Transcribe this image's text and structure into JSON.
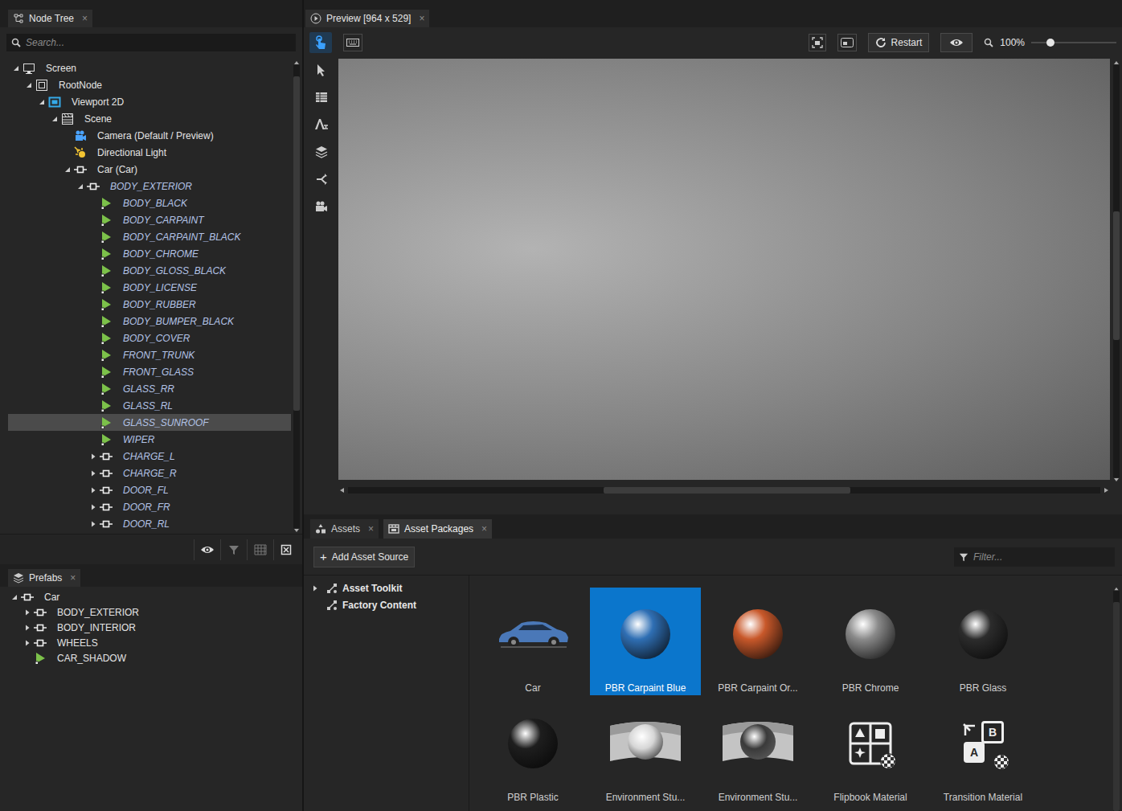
{
  "node_tree": {
    "title": "Node Tree",
    "close": "×",
    "search": {
      "placeholder": "Search..."
    },
    "items": [
      {
        "label": "Screen",
        "kind": "screen",
        "selected": false,
        "prefab_instance": false,
        "expanded": true,
        "children": [
          {
            "label": "RootNode",
            "kind": "root",
            "selected": false,
            "prefab_instance": false,
            "expanded": true,
            "children": [
              {
                "label": "Viewport 2D",
                "kind": "viewport",
                "selected": false,
                "prefab_instance": false,
                "expanded": true,
                "children": [
                  {
                    "label": "Scene",
                    "kind": "scene",
                    "selected": false,
                    "prefab_instance": false,
                    "expanded": true,
                    "children": [
                      {
                        "label": "Camera (Default / Preview)",
                        "kind": "camera",
                        "selected": false,
                        "prefab_instance": false
                      },
                      {
                        "label": "Directional Light",
                        "kind": "light",
                        "selected": false,
                        "prefab_instance": false
                      },
                      {
                        "label": "Car (Car)",
                        "kind": "node",
                        "selected": false,
                        "prefab_instance": false,
                        "expanded": true,
                        "children": [
                          {
                            "label": "BODY_EXTERIOR",
                            "kind": "node",
                            "selected": false,
                            "prefab_instance": true,
                            "expanded": true,
                            "children": [
                              {
                                "label": "BODY_BLACK",
                                "kind": "mesh",
                                "selected": false,
                                "prefab_instance": true
                              },
                              {
                                "label": "BODY_CARPAINT",
                                "kind": "mesh",
                                "selected": false,
                                "prefab_instance": true
                              },
                              {
                                "label": "BODY_CARPAINT_BLACK",
                                "kind": "mesh",
                                "selected": false,
                                "prefab_instance": true
                              },
                              {
                                "label": "BODY_CHROME",
                                "kind": "mesh",
                                "selected": false,
                                "prefab_instance": true
                              },
                              {
                                "label": "BODY_GLOSS_BLACK",
                                "kind": "mesh",
                                "selected": false,
                                "prefab_instance": true
                              },
                              {
                                "label": "BODY_LICENSE",
                                "kind": "mesh",
                                "selected": false,
                                "prefab_instance": true
                              },
                              {
                                "label": "BODY_RUBBER",
                                "kind": "mesh",
                                "selected": false,
                                "prefab_instance": true
                              },
                              {
                                "label": "BODY_BUMPER_BLACK",
                                "kind": "mesh",
                                "selected": false,
                                "prefab_instance": true
                              },
                              {
                                "label": "BODY_COVER",
                                "kind": "mesh",
                                "selected": false,
                                "prefab_instance": true
                              },
                              {
                                "label": "FRONT_TRUNK",
                                "kind": "mesh",
                                "selected": false,
                                "prefab_instance": true
                              },
                              {
                                "label": "FRONT_GLASS",
                                "kind": "mesh",
                                "selected": false,
                                "prefab_instance": true
                              },
                              {
                                "label": "GLASS_RR",
                                "kind": "mesh",
                                "selected": false,
                                "prefab_instance": true
                              },
                              {
                                "label": "GLASS_RL",
                                "kind": "mesh",
                                "selected": false,
                                "prefab_instance": true
                              },
                              {
                                "label": "GLASS_SUNROOF",
                                "kind": "mesh",
                                "selected": true,
                                "prefab_instance": true
                              },
                              {
                                "label": "WIPER",
                                "kind": "mesh",
                                "selected": false,
                                "prefab_instance": true
                              },
                              {
                                "label": "CHARGE_L",
                                "kind": "node",
                                "selected": false,
                                "prefab_instance": true,
                                "expanded": false
                              },
                              {
                                "label": "CHARGE_R",
                                "kind": "node",
                                "selected": false,
                                "prefab_instance": true,
                                "expanded": false
                              },
                              {
                                "label": "DOOR_FL",
                                "kind": "node",
                                "selected": false,
                                "prefab_instance": true,
                                "expanded": false
                              },
                              {
                                "label": "DOOR_FR",
                                "kind": "node",
                                "selected": false,
                                "prefab_instance": true,
                                "expanded": false
                              },
                              {
                                "label": "DOOR_RL",
                                "kind": "node",
                                "selected": false,
                                "prefab_instance": true,
                                "expanded": false
                              }
                            ]
                          }
                        ]
                      }
                    ]
                  }
                ]
              }
            ]
          }
        ]
      }
    ]
  },
  "prefabs": {
    "title": "Prefabs",
    "close": "×",
    "items": [
      {
        "label": "Car",
        "kind": "node",
        "selected": false,
        "expanded": true,
        "children": [
          {
            "label": "BODY_EXTERIOR",
            "kind": "node",
            "selected": false,
            "expanded": false
          },
          {
            "label": "BODY_INTERIOR",
            "kind": "node",
            "selected": false,
            "expanded": false
          },
          {
            "label": "WHEELS",
            "kind": "node",
            "selected": false,
            "expanded": false
          },
          {
            "label": "CAR_SHADOW",
            "kind": "mesh",
            "selected": false
          }
        ]
      }
    ]
  },
  "preview": {
    "title": "Preview [964 x 529]",
    "close": "×",
    "interact": {
      "on": true
    },
    "keyboard": {
      "on": false
    },
    "restart": "Restart",
    "zoom": {
      "reading": "100%",
      "level": 0.23
    }
  },
  "assets": {
    "tabs": [
      {
        "label": "Assets",
        "close": "×",
        "selected": false
      },
      {
        "label": "Asset Packages",
        "close": "×",
        "selected": true
      }
    ],
    "add_icon": "+",
    "add_button": "Add Asset Source",
    "filter": {
      "placeholder": "Filter..."
    },
    "sources": [
      {
        "label": "Asset Toolkit",
        "expanded": false
      },
      {
        "label": "Factory Content"
      }
    ],
    "items": [
      {
        "label": "Car",
        "kind": "car",
        "selected": false
      },
      {
        "label": "PBR Carpaint Blue",
        "kind": "sphere",
        "color": "#2f6fb4",
        "selected": true
      },
      {
        "label": "PBR Carpaint Or...",
        "kind": "sphere",
        "color": "#c8582a",
        "selected": false
      },
      {
        "label": "PBR Chrome",
        "kind": "sphere",
        "color": "#8a8a8a",
        "selected": false
      },
      {
        "label": "PBR Glass",
        "kind": "sphere",
        "color": "#2c2c2c",
        "selected": false
      },
      {
        "label": "PBR Plastic",
        "kind": "sphere",
        "color": "#1e1e1e",
        "selected": false
      },
      {
        "label": "Environment Stu...",
        "kind": "environment",
        "color": "#d6d6d6",
        "selected": false
      },
      {
        "label": "Environment Stu...",
        "kind": "environment",
        "color": "#3a3a3a",
        "selected": false
      },
      {
        "label": "Flipbook Material",
        "kind": "flipbook",
        "selected": false
      },
      {
        "label": "Transition Material",
        "kind": "transition",
        "icon_text": [
          "A",
          "B"
        ],
        "selected": false
      }
    ]
  }
}
